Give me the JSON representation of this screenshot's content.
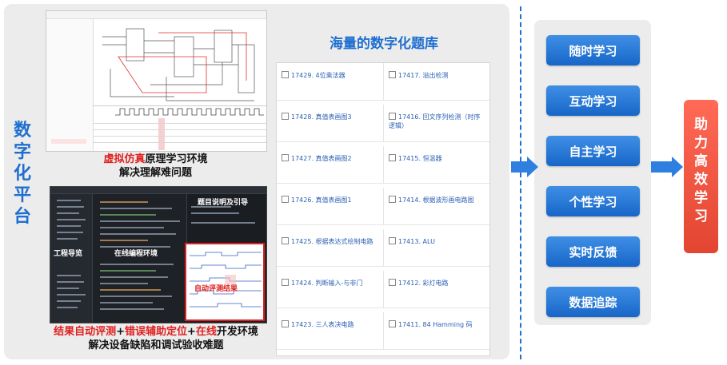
{
  "platform": {
    "label": "数字化平台"
  },
  "captions": {
    "sim_red": "虚拟仿真",
    "sim_rest": "原理学习环境",
    "sim_line2": "解决理解难问题",
    "ide_red1": "结果自动评测",
    "ide_plus1": "+",
    "ide_red2": "错误辅助定位",
    "ide_plus2": "+",
    "ide_red3": "在线",
    "ide_rest": "开发环境",
    "ide_line2": "解决设备缺陷和调试验收难题"
  },
  "ide_annotations": {
    "project_nav": "工程导览",
    "online_env": "在线编程环境",
    "problem_desc": "题目说明及引导",
    "auto_eval": "自动评测结果"
  },
  "bank": {
    "title": "海量的数字化题库",
    "rows": [
      {
        "left": "17429. 4位乘法器",
        "right": "17417. 溢出检测"
      },
      {
        "left": "17428. 真值表画图3",
        "right": "17416. 回文序列检测（时序逻辑）"
      },
      {
        "left": "17427. 真值表画图2",
        "right": "17415. 恒温器"
      },
      {
        "left": "17426. 真值表画图1",
        "right": "17414. 根据波形画电路图"
      },
      {
        "left": "17425. 根据表达式绘制电路",
        "right": "17413. ALU"
      },
      {
        "left": "17424. 判断输入-与非门",
        "right": "17412. 彩灯电路"
      },
      {
        "left": "17423. 三人表决电路",
        "right": "17411. 84 Hamming 码"
      }
    ]
  },
  "modes": [
    "随时学习",
    "互动学习",
    "自主学习",
    "个性学习",
    "实时反馈",
    "数据追踪"
  ],
  "result": {
    "label": "助力高效学习"
  },
  "colors": {
    "primary": "#1f6fd0",
    "accent": "#e02020",
    "result": "#e24531"
  }
}
